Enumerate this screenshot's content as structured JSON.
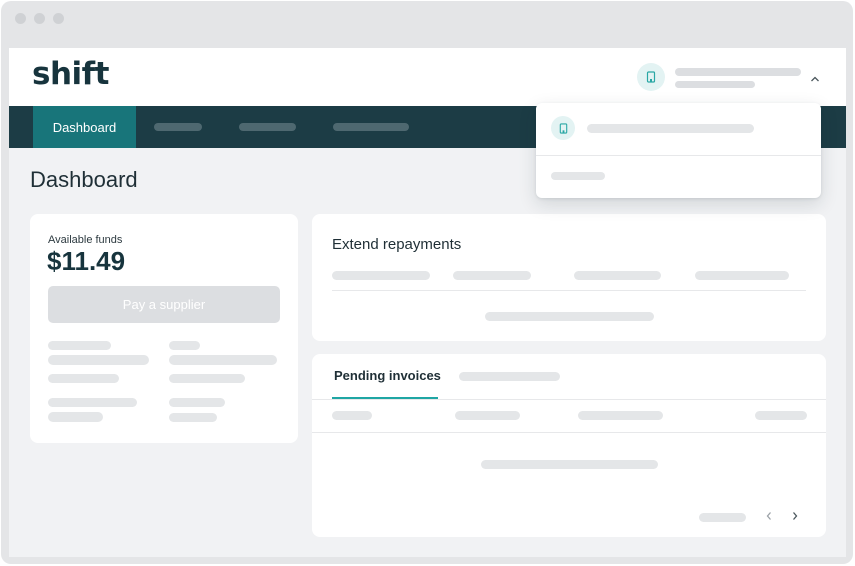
{
  "brand": {
    "logo_text": "shift",
    "accent_color": "#1fa6a4",
    "nav_color": "#1c3c45",
    "active_tab_color": "#18757a"
  },
  "header": {
    "account_icon": "building-icon",
    "menu_icon": "chevron-up-icon"
  },
  "nav": {
    "active_label": "Dashboard"
  },
  "page": {
    "title": "Dashboard"
  },
  "funds_card": {
    "label": "Available funds",
    "value": "$11.49",
    "button_label": "Pay a supplier"
  },
  "repayments_card": {
    "title": "Extend repayments"
  },
  "invoices_card": {
    "tab_active": "Pending invoices",
    "prev_icon": "chevron-left-icon",
    "next_icon": "chevron-right-icon"
  },
  "dropdown": {
    "item_icon": "building-icon"
  }
}
